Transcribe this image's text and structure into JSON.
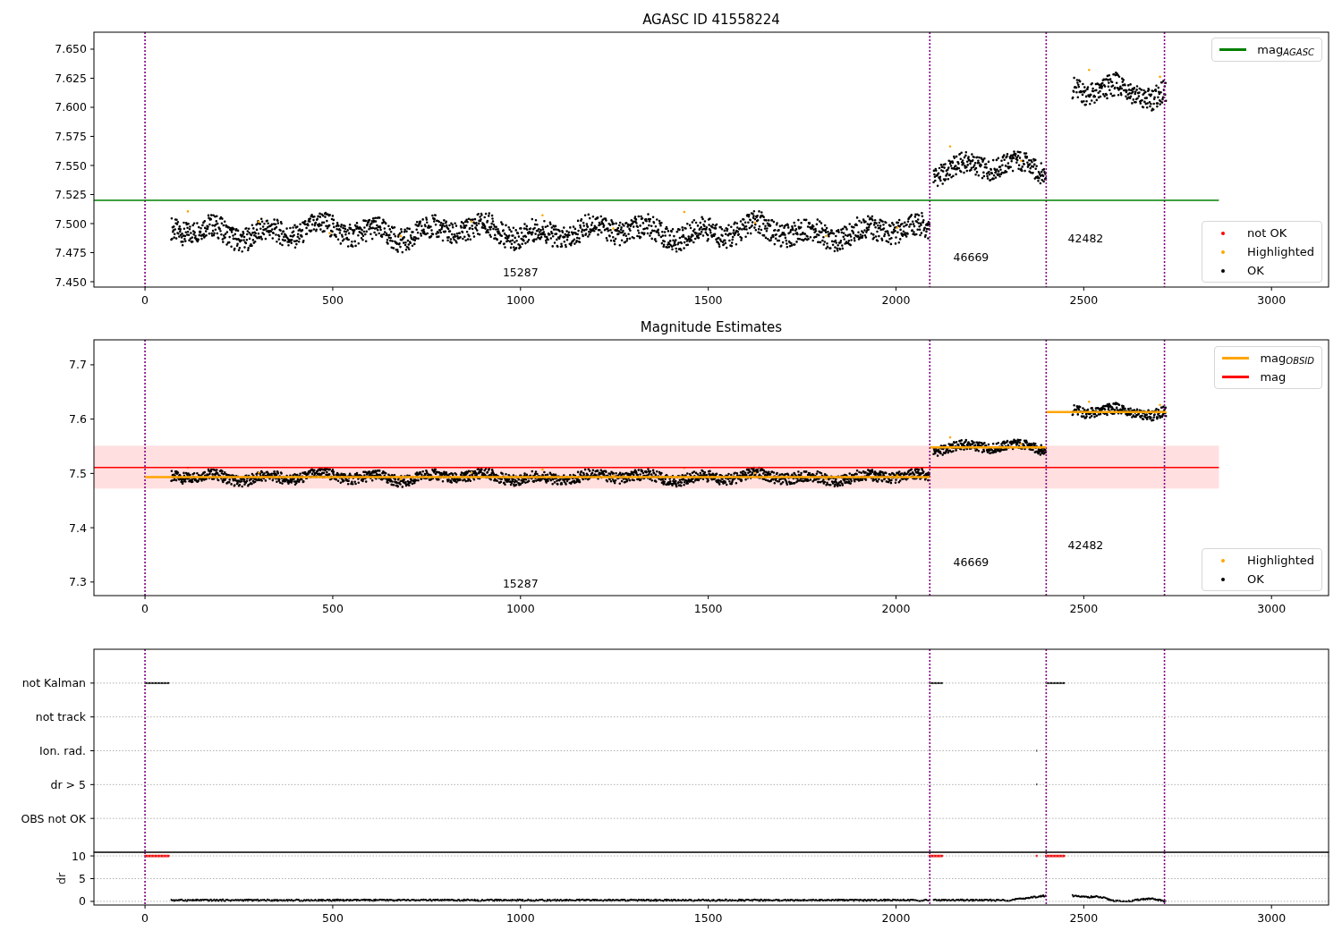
{
  "panels": [
    {
      "chart_data": {
        "type": "line",
        "title": "AGASC ID 41558224",
        "xlim": [
          -136,
          3152
        ],
        "ylim": [
          7.4454,
          7.6646
        ],
        "xticks": [
          0,
          500,
          1000,
          1500,
          2000,
          2500,
          3000
        ],
        "yticks": [
          {
            "value": 7.45,
            "label": "7.450"
          },
          {
            "value": 7.475,
            "label": "7.475"
          },
          {
            "value": 7.5,
            "label": "7.500"
          },
          {
            "value": 7.525,
            "label": "7.525"
          },
          {
            "value": 7.55,
            "label": "7.550"
          },
          {
            "value": 7.575,
            "label": "7.575"
          },
          {
            "value": 7.6,
            "label": "7.600"
          },
          {
            "value": 7.625,
            "label": "7.625"
          },
          {
            "value": 7.65,
            "label": "7.650"
          }
        ],
        "x": [
          -136,
          2860
        ],
        "series": [
          {
            "name": "mag$_{AGASC}$",
            "color": "#008000",
            "values": [
              7.52,
              7.52
            ]
          }
        ]
      },
      "obsid_labels": [
        "15287",
        "46669",
        "42482"
      ],
      "point_legend": [
        {
          "label": "not OK",
          "color": "#ff0000"
        },
        {
          "label": "Highlighted",
          "color": "#ffa500"
        },
        {
          "label": "OK",
          "color": "#000000"
        }
      ]
    },
    {
      "chart_data": {
        "type": "line",
        "title": "Magnitude Estimates",
        "xlim": [
          -136,
          3152
        ],
        "ylim": [
          7.275,
          7.746
        ],
        "xticks": [
          0,
          500,
          1000,
          1500,
          2000,
          2500,
          3000
        ],
        "yticks": [
          {
            "value": 7.3,
            "label": "7.3"
          },
          {
            "value": 7.4,
            "label": "7.4"
          },
          {
            "value": 7.5,
            "label": "7.5"
          },
          {
            "value": 7.6,
            "label": "7.6"
          },
          {
            "value": 7.7,
            "label": "7.7"
          }
        ],
        "x": [
          -136,
          0,
          2090,
          2090.5,
          2091,
          2400,
          2400.5,
          2401,
          2720,
          2860
        ],
        "series": [
          {
            "name": "mag$_{OBSID}$",
            "color": "#ffa500",
            "values": [
              null,
              7.493,
              7.493,
              null,
              7.548,
              7.548,
              null,
              7.613,
              7.613,
              null
            ]
          },
          {
            "name": "mag",
            "color": "#ff0000",
            "values": [
              7.511,
              7.511,
              7.511,
              7.511,
              7.511,
              7.511,
              7.511,
              7.511,
              7.511,
              7.511
            ]
          }
        ]
      },
      "obsid_labels": [
        "15287",
        "46669",
        "42482"
      ],
      "point_legend": [
        {
          "label": "Highlighted",
          "color": "#ffa500"
        },
        {
          "label": "OK",
          "color": "#000000"
        }
      ]
    }
  ],
  "flags": {
    "chart_data": {
      "type": "scatter",
      "orientation": "horizontal",
      "grid": true,
      "xlim": [
        -136,
        3152
      ],
      "categories": [
        "not Kalman",
        "not track",
        "Ion. rad.",
        "dr > 5",
        "OBS not OK"
      ]
    }
  },
  "dr": {
    "chart_data": {
      "type": "scatter",
      "grid": true,
      "ylabel": "dr",
      "xlim": [
        -136,
        3152
      ],
      "ylim": [
        -0.8,
        10.8
      ],
      "xticks": [
        0,
        500,
        1000,
        1500,
        2000,
        2500,
        3000
      ],
      "yticks": [
        0,
        5,
        10
      ]
    }
  }
}
